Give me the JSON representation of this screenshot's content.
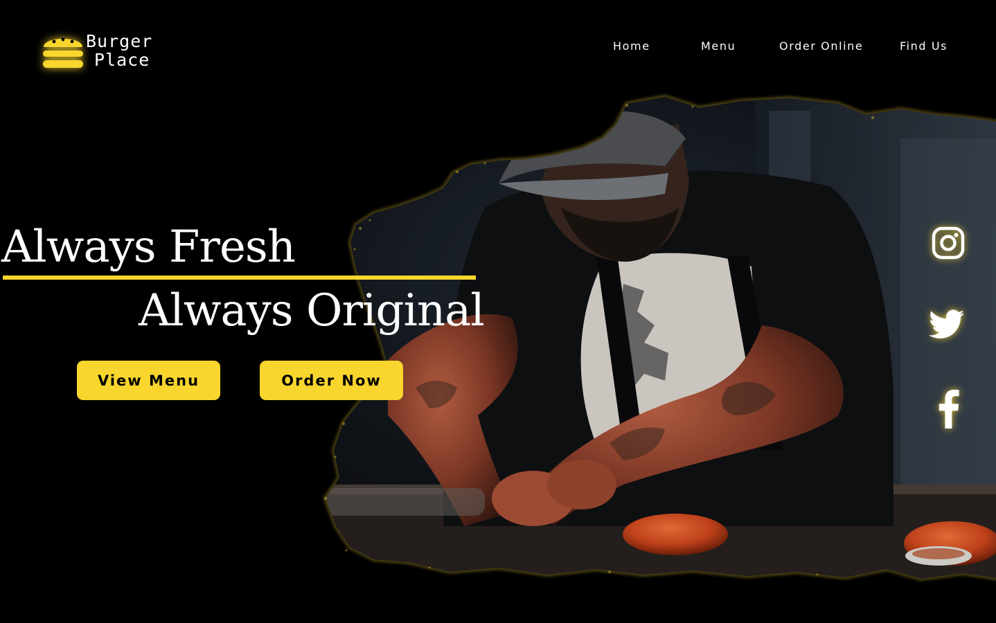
{
  "brand": {
    "line1": "Burger",
    "line2": "Place",
    "accent_color": "#f9d62e"
  },
  "nav": {
    "items": [
      {
        "label": "Home"
      },
      {
        "label": "Menu"
      },
      {
        "label": "Order Online"
      },
      {
        "label": "Find Us"
      }
    ]
  },
  "hero": {
    "headline_1": "Always Fresh",
    "headline_2": "Always Original",
    "buttons": {
      "view_menu": "View Menu",
      "order_now": "Order Now"
    },
    "photo": "chef preparing burgers (photo with brush-stroke edges)"
  },
  "social": {
    "icons": [
      "instagram-icon",
      "twitter-icon",
      "facebook-icon"
    ]
  }
}
